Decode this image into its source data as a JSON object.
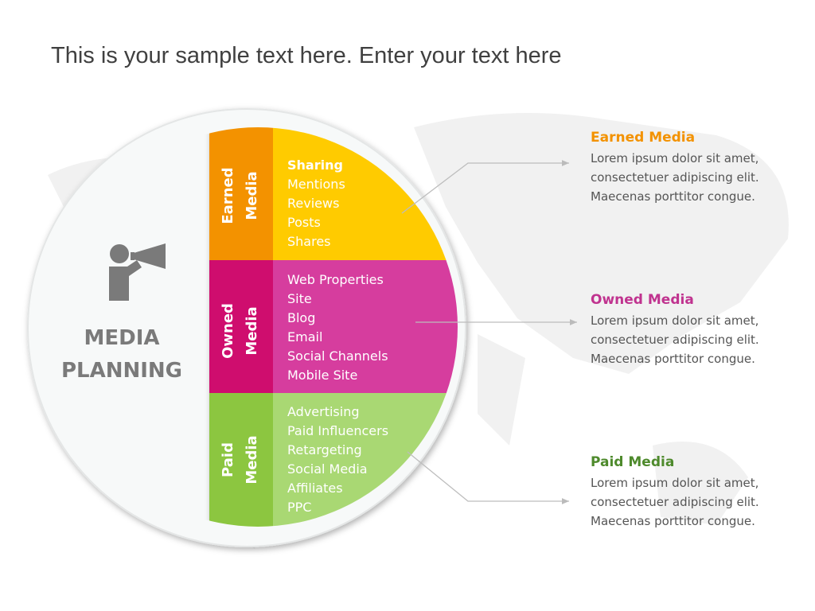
{
  "title": "This is your sample text here. Enter your text here",
  "center": {
    "line1": "MEDIA",
    "line2": "PLANNING",
    "icon": "megaphone-person-icon"
  },
  "colors": {
    "earned_label": "#F39200",
    "earned_fill": "#FFCB05",
    "owned_label": "#CF0A6E",
    "owned_fill": "#D63D9E",
    "paid_label": "#8CC63F",
    "paid_fill": "#A9D873",
    "earned_heading": "#F39200",
    "owned_heading": "#C0338F",
    "paid_heading": "#4E8A2C"
  },
  "segments": [
    {
      "label1": "Earned",
      "label2": "Media",
      "items": [
        "Sharing",
        "Mentions",
        "Reviews",
        "Posts",
        "Shares"
      ]
    },
    {
      "label1": "Owned",
      "label2": "Media",
      "items": [
        "Web Properties",
        "Site",
        "Blog",
        "Email",
        "Social Channels",
        "Mobile Site"
      ]
    },
    {
      "label1": "Paid",
      "label2": "Media",
      "items": [
        "Advertising",
        "Paid Influencers",
        "Retargeting",
        "Social Media",
        "Affiliates",
        "PPC"
      ]
    }
  ],
  "descriptions": [
    {
      "heading": "Earned Media",
      "lines": [
        "Lorem ipsum dolor sit amet,",
        "consectetuer adipiscing elit.",
        "Maecenas porttitor congue."
      ]
    },
    {
      "heading": "Owned Media",
      "lines": [
        "Lorem ipsum dolor sit amet,",
        "consectetuer adipiscing elit.",
        "Maecenas porttitor congue."
      ]
    },
    {
      "heading": "Paid Media",
      "lines": [
        "Lorem ipsum dolor sit amet,",
        "consectetuer adipiscing elit.",
        "Maecenas porttitor congue."
      ]
    }
  ]
}
